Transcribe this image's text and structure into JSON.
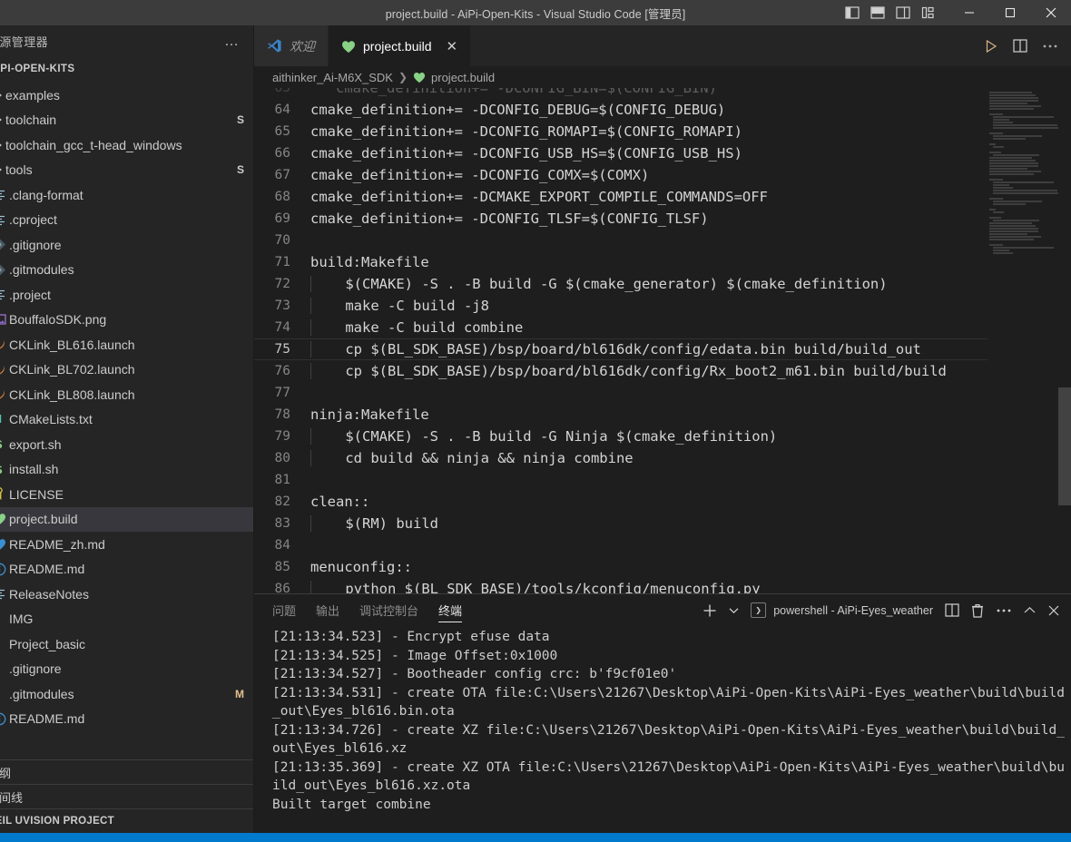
{
  "titlebar": {
    "title": "project.build - AiPi-Open-Kits - Visual Studio Code [管理员]",
    "layout_icons": [
      "toggle-primary-sidebar-icon",
      "toggle-panel-icon",
      "toggle-secondary-sidebar-icon",
      "customize-layout-icon"
    ],
    "window_buttons": [
      "minimize",
      "maximize",
      "close"
    ]
  },
  "sidebar": {
    "header_title": "资源管理器",
    "more_actions": "…",
    "project_name": "AIPI-OPEN-KITS",
    "items": [
      {
        "label": "examples",
        "kind": "folder",
        "icon": "chevron-right-icon",
        "badge": ""
      },
      {
        "label": "toolchain",
        "kind": "folder",
        "icon": "chevron-right-icon",
        "badge": "S"
      },
      {
        "label": "toolchain_gcc_t-head_windows",
        "kind": "folder",
        "icon": "chevron-right-icon",
        "badge": ""
      },
      {
        "label": "tools",
        "kind": "folder",
        "icon": "chevron-right-icon",
        "badge": "S"
      },
      {
        "label": ".clang-format",
        "kind": "file",
        "icon": "config-file-icon",
        "badge": ""
      },
      {
        "label": ".cproject",
        "kind": "file",
        "icon": "config-file-icon",
        "badge": ""
      },
      {
        "label": ".gitignore",
        "kind": "file",
        "icon": "git-file-icon",
        "badge": ""
      },
      {
        "label": ".gitmodules",
        "kind": "file",
        "icon": "git-file-icon",
        "badge": ""
      },
      {
        "label": ".project",
        "kind": "file",
        "icon": "config-file-icon",
        "badge": ""
      },
      {
        "label": "BouffaloSDK.png",
        "kind": "file",
        "icon": "image-file-icon",
        "badge": ""
      },
      {
        "label": "CKLink_BL616.launch",
        "kind": "file",
        "icon": "launch-file-icon",
        "badge": ""
      },
      {
        "label": "CKLink_BL702.launch",
        "kind": "file",
        "icon": "launch-file-icon",
        "badge": ""
      },
      {
        "label": "CKLink_BL808.launch",
        "kind": "file",
        "icon": "launch-file-icon",
        "badge": ""
      },
      {
        "label": "CMakeLists.txt",
        "kind": "file",
        "icon": "cmake-file-icon",
        "badge": ""
      },
      {
        "label": "export.sh",
        "kind": "file",
        "icon": "shell-file-icon",
        "badge": ""
      },
      {
        "label": "install.sh",
        "kind": "file",
        "icon": "shell-file-icon",
        "badge": ""
      },
      {
        "label": "LICENSE",
        "kind": "file",
        "icon": "license-file-icon",
        "badge": ""
      },
      {
        "label": "project.build",
        "kind": "file",
        "icon": "build-file-icon",
        "badge": "",
        "selected": true
      },
      {
        "label": "README_zh.md",
        "kind": "file",
        "icon": "markdown-zh-icon",
        "badge": ""
      },
      {
        "label": "README.md",
        "kind": "file",
        "icon": "info-file-icon",
        "badge": ""
      },
      {
        "label": "ReleaseNotes",
        "kind": "file",
        "icon": "config-file-icon",
        "badge": ""
      },
      {
        "label": "IMG",
        "kind": "file",
        "icon": "generic-file-icon",
        "badge": ""
      },
      {
        "label": "Project_basic",
        "kind": "file",
        "icon": "generic-file-icon",
        "badge": ""
      },
      {
        "label": ".gitignore",
        "kind": "file",
        "icon": "generic-file-icon",
        "badge": ""
      },
      {
        "label": ".gitmodules",
        "kind": "file",
        "icon": "generic-file-icon",
        "badge": "M"
      },
      {
        "label": "README.md",
        "kind": "file",
        "icon": "info-file-icon",
        "badge": ""
      }
    ],
    "collapsed_panels": [
      {
        "label": "大纲",
        "icon": "chevron-right-icon"
      },
      {
        "label": "时间线",
        "icon": "chevron-right-icon"
      },
      {
        "label": "KEIL UVISION PROJECT",
        "icon": "chevron-right-icon"
      }
    ]
  },
  "editor": {
    "tabs": [
      {
        "label": "欢迎",
        "icon": "vscode-logo-icon",
        "active": false,
        "closable": false
      },
      {
        "label": "project.build",
        "icon": "build-file-icon",
        "active": true,
        "closable": true,
        "close_glyph": "✕"
      }
    ],
    "actions": [
      "run-button",
      "split-editor-icon",
      "more-actions-icon"
    ],
    "breadcrumb": {
      "root": "aithinker_Ai-M6X_SDK",
      "separator": "❯",
      "file": "project.build",
      "file_icon": "build-file-icon"
    },
    "lines": [
      {
        "no": "63",
        "text": "   cmake_definition+= -DCONFIG_BIN=$(CONFIG_BIN)",
        "partial": true
      },
      {
        "no": "64",
        "text": "cmake_definition+= -DCONFIG_DEBUG=$(CONFIG_DEBUG)"
      },
      {
        "no": "65",
        "text": "cmake_definition+= -DCONFIG_ROMAPI=$(CONFIG_ROMAPI)"
      },
      {
        "no": "66",
        "text": "cmake_definition+= -DCONFIG_USB_HS=$(CONFIG_USB_HS)"
      },
      {
        "no": "67",
        "text": "cmake_definition+= -DCONFIG_COMX=$(COMX)"
      },
      {
        "no": "68",
        "text": "cmake_definition+= -DCMAKE_EXPORT_COMPILE_COMMANDS=OFF"
      },
      {
        "no": "69",
        "text": "cmake_definition+= -DCONFIG_TLSF=$(CONFIG_TLSF)"
      },
      {
        "no": "70",
        "text": ""
      },
      {
        "no": "71",
        "text": "build:Makefile"
      },
      {
        "no": "72",
        "text": "    $(CMAKE) -S . -B build -G $(cmake_generator) $(cmake_definition)",
        "indent": true
      },
      {
        "no": "73",
        "text": "    make -C build -j8",
        "indent": true
      },
      {
        "no": "74",
        "text": "    make -C build combine",
        "indent": true
      },
      {
        "no": "75",
        "text": "    cp $(BL_SDK_BASE)/bsp/board/bl616dk/config/edata.bin build/build_out",
        "indent": true,
        "cursor": true
      },
      {
        "no": "76",
        "text": "    cp $(BL_SDK_BASE)/bsp/board/bl616dk/config/Rx_boot2_m61.bin build/build",
        "indent": true
      },
      {
        "no": "77",
        "text": ""
      },
      {
        "no": "78",
        "text": "ninja:Makefile"
      },
      {
        "no": "79",
        "text": "    $(CMAKE) -S . -B build -G Ninja $(cmake_definition)",
        "indent": true
      },
      {
        "no": "80",
        "text": "    cd build && ninja && ninja combine",
        "indent": true
      },
      {
        "no": "81",
        "text": ""
      },
      {
        "no": "82",
        "text": "clean::"
      },
      {
        "no": "83",
        "text": "    $(RM) build",
        "indent": true
      },
      {
        "no": "84",
        "text": ""
      },
      {
        "no": "85",
        "text": "menuconfig::"
      },
      {
        "no": "86",
        "text": "    python $(BL_SDK_BASE)/tools/kconfig/menuconfig.py",
        "indent": true
      }
    ]
  },
  "panel": {
    "tabs": [
      {
        "label": "问题",
        "active": false
      },
      {
        "label": "输出",
        "active": false
      },
      {
        "label": "调试控制台",
        "active": false
      },
      {
        "label": "终端",
        "active": true
      }
    ],
    "actions": {
      "new_terminal": "+",
      "new_terminal_dropdown": "⌄",
      "terminal_name": "powershell - AiPi-Eyes_weather",
      "terminal_chip": "❯",
      "split_icon": "split-terminal-icon",
      "kill_icon": "trash-icon",
      "more_icon": "more-actions-icon",
      "maximize_icon": "chevron-up-icon",
      "close_icon": "close-icon"
    },
    "terminal_output": "[21:13:34.523] - Encrypt efuse data\n[21:13:34.525] - Image Offset:0x1000\n[21:13:34.527] - Bootheader config crc: b'f9cf01e0'\n[21:13:34.531] - create OTA file:C:\\Users\\21267\\Desktop\\AiPi-Open-Kits\\AiPi-Eyes_weather\\build\\build_out\\Eyes_bl616.bin.ota\n[21:13:34.726] - create XZ file:C:\\Users\\21267\\Desktop\\AiPi-Open-Kits\\AiPi-Eyes_weather\\build\\build_out\\Eyes_bl616.xz\n[21:13:35.369] - create XZ OTA file:C:\\Users\\21267\\Desktop\\AiPi-Open-Kits\\AiPi-Eyes_weather\\build\\build_out\\Eyes_bl616.xz.ota\nBuilt target combine"
  },
  "colors": {
    "titlebar_bg": "#3c3c3c",
    "sidebar_bg": "#252526",
    "editor_bg": "#1e1e1e",
    "tab_active_bg": "#1e1e1e",
    "tab_inactive_bg": "#2d2d2d",
    "selection_bg": "#37373d",
    "statusbar_bg": "#007acc",
    "accent_green": "#89d185",
    "line_number": "#858585",
    "text": "#cccccc"
  }
}
